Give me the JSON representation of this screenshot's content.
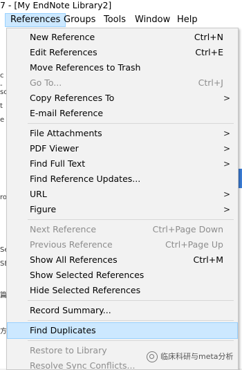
{
  "window": {
    "title": "7 - [My EndNote Library2]"
  },
  "menubar": {
    "items": [
      "References",
      "Groups",
      "Tools",
      "Window",
      "Help"
    ],
    "active": "References"
  },
  "left_fragments": [
    "c",
    "-",
    "so",
    "t",
    "e",
    "ro",
    "Se",
    "SE",
    "篇",
    "方"
  ],
  "menu": {
    "items": [
      {
        "label": "New Reference",
        "shortcut": "Ctrl+N"
      },
      {
        "label": "Edit References",
        "shortcut": "Ctrl+E"
      },
      {
        "label": "Move References to Trash",
        "shortcut": ""
      },
      {
        "label": "Go To...",
        "shortcut": "Ctrl+J"
      },
      {
        "label": "Copy References To",
        "submenu": ">"
      },
      {
        "label": "E-mail Reference",
        "shortcut": ""
      },
      {
        "label": "File Attachments",
        "submenu": ">"
      },
      {
        "label": "PDF Viewer",
        "submenu": ">"
      },
      {
        "label": "Find Full Text",
        "submenu": ">"
      },
      {
        "label": "Find Reference Updates...",
        "shortcut": ""
      },
      {
        "label": "URL",
        "submenu": ">"
      },
      {
        "label": "Figure",
        "submenu": ">"
      },
      {
        "label": "Next Reference",
        "shortcut": "Ctrl+Page Down"
      },
      {
        "label": "Previous Reference",
        "shortcut": "Ctrl+Page Up"
      },
      {
        "label": "Show All References",
        "shortcut": "Ctrl+M"
      },
      {
        "label": "Show Selected References",
        "shortcut": ""
      },
      {
        "label": "Hide Selected References",
        "shortcut": ""
      },
      {
        "label": "Record Summary...",
        "shortcut": ""
      },
      {
        "label": "Find Duplicates",
        "shortcut": ""
      },
      {
        "label": "Restore to Library",
        "shortcut": ""
      },
      {
        "label": "Resolve Sync Conflicts...",
        "shortcut": ""
      }
    ]
  },
  "watermark": {
    "text": "临床科研与meta分析"
  }
}
